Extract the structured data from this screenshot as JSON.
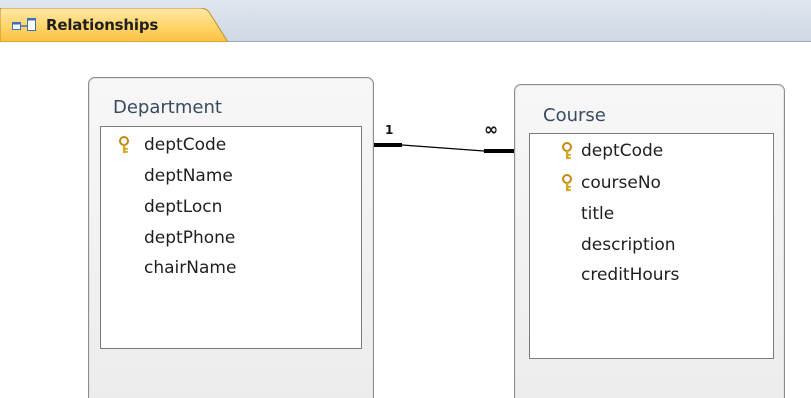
{
  "tab": {
    "label": "Relationships",
    "icon": "relationships-icon"
  },
  "tables": {
    "department": {
      "title": "Department",
      "fields": [
        {
          "name": "deptCode",
          "primary_key": true
        },
        {
          "name": "deptName",
          "primary_key": false
        },
        {
          "name": "deptLocn",
          "primary_key": false
        },
        {
          "name": "deptPhone",
          "primary_key": false
        },
        {
          "name": "chairName",
          "primary_key": false
        }
      ]
    },
    "course": {
      "title": "Course",
      "fields": [
        {
          "name": "deptCode",
          "primary_key": true
        },
        {
          "name": "courseNo",
          "primary_key": true
        },
        {
          "name": "title",
          "primary_key": false
        },
        {
          "name": "description",
          "primary_key": false
        },
        {
          "name": "creditHours",
          "primary_key": false
        }
      ]
    }
  },
  "relationship": {
    "one_side_label": "1",
    "many_side_label": "∞"
  },
  "colors": {
    "tab_accent": "#f5a623",
    "key_gold": "#d8a51c",
    "title_text": "#3a4a5e"
  }
}
